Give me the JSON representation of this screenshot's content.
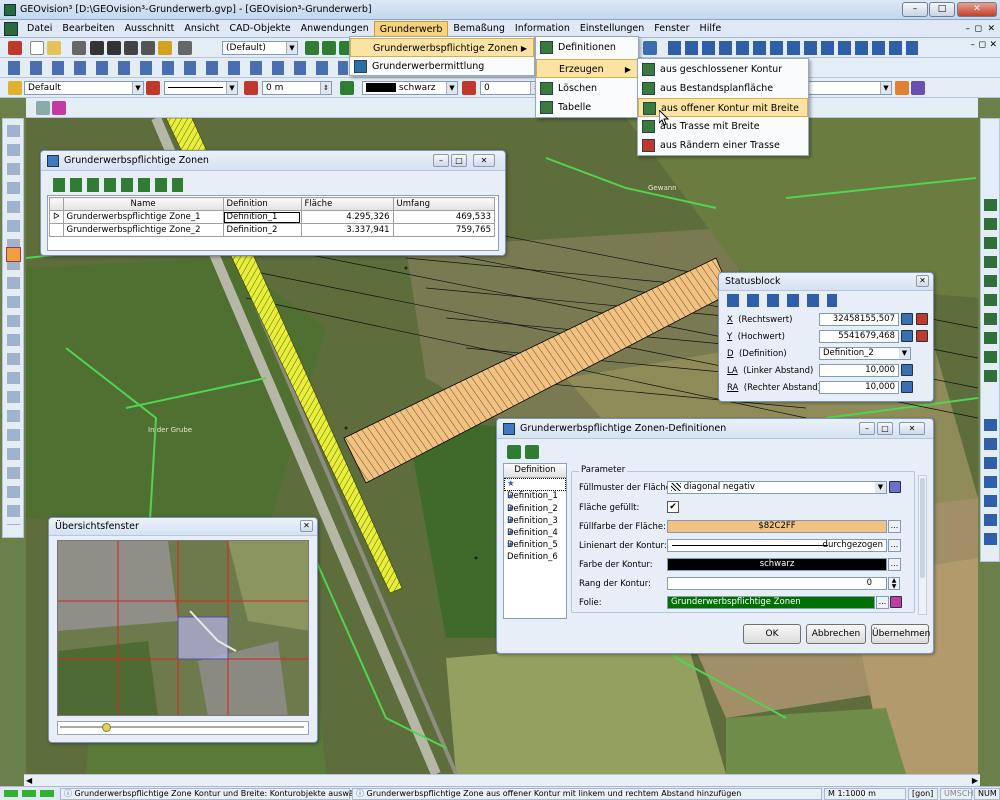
{
  "window": {
    "title": "GEOvision³  [D:\\GEOvision³-Grunderwerb.gvp] - [GEOvision³-Grunderwerb]"
  },
  "menubar": {
    "items": [
      "Datei",
      "Bearbeiten",
      "Ausschnitt",
      "Ansicht",
      "CAD-Objekte",
      "Anwendungen",
      "Grunderwerb",
      "Bemaßung",
      "Information",
      "Einstellungen",
      "Fenster",
      "Hilfe"
    ]
  },
  "toolbar1": {
    "layer_combo": "(Default)"
  },
  "toolbar3": {
    "style_combo": "Default",
    "offset_value": "0 m",
    "color_value": "schwarz",
    "number_value": "0"
  },
  "colors": {
    "accent_orange": "#F2C282",
    "menu_highlight": "#FBE3A3",
    "folie_green": "#007000",
    "title_blue": "#DBE7F5"
  },
  "menus": {
    "level1": {
      "items": [
        "Grunderwerbspflichtige Zonen",
        "Grunderwerbermittlung"
      ]
    },
    "level2": {
      "items": [
        "Definitionen",
        "Erzeugen",
        "Löschen",
        "Tabelle"
      ]
    },
    "level3": {
      "items": [
        "aus geschlossener Kontur",
        "aus Bestandsplanfläche",
        "aus offener Kontur mit Breite",
        "aus Trasse mit Breite",
        "aus Rändern einer Trasse"
      ]
    }
  },
  "zones_window": {
    "title": "Grunderwerbspflichtige Zonen",
    "columns": [
      "Name",
      "Definition",
      "Fläche",
      "Umfang"
    ],
    "rows": [
      {
        "marker": "ᐅ",
        "name": "Grunderwerbspflichtige Zone_1",
        "definition": "Definition_1",
        "flaeche": "4.295,326",
        "umfang": "469,533"
      },
      {
        "marker": "",
        "name": "Grunderwerbspflichtige Zone_2",
        "definition": "Definition_2",
        "flaeche": "3.337,941",
        "umfang": "759,765"
      }
    ]
  },
  "statusblock": {
    "title": "Statusblock",
    "rows": [
      {
        "key": "X",
        "label": "(Rechtswert)",
        "value": "32458155,507"
      },
      {
        "key": "Y",
        "label": "(Hochwert)",
        "value": "5541679,468"
      },
      {
        "key": "D",
        "label": "(Definition)",
        "value": "Definition_2"
      },
      {
        "key": "LA",
        "label": "(Linker Abstand)",
        "value": "10,000"
      },
      {
        "key": "RA",
        "label": "(Rechter Abstand)",
        "value": "10,000"
      }
    ]
  },
  "definitions_window": {
    "title": "Grunderwerbspflichtige Zonen-Definitionen",
    "list_header": "Definition",
    "list": [
      "Definition_1",
      "Definition_2",
      "Definition_3",
      "Definition_4",
      "Definition_5",
      "Definition_6"
    ],
    "group_title": "Parameter",
    "params": {
      "fuellmuster_label": "Füllmuster der Fläche:",
      "fuellmuster_value": "diagonal negativ",
      "gefuellt_label": "Fläche gefüllt:",
      "gefuellt_check": "✔",
      "fuellfarbe_label": "Füllfarbe der Fläche:",
      "fuellfarbe_value": "$82C2FF",
      "linienart_label": "Linienart der Kontur:",
      "linienart_value": "durchgezogen",
      "farbe_label": "Farbe der Kontur:",
      "farbe_value": "schwarz",
      "rang_label": "Rang der Kontur:",
      "rang_value": "0",
      "folie_label": "Folie:",
      "folie_value": "Grunderwerbspflichtige Zonen"
    },
    "buttons": {
      "ok": "OK",
      "cancel": "Abbrechen",
      "apply": "Übernehmen"
    }
  },
  "overview_window": {
    "title": "Übersichtsfenster"
  },
  "map_labels": {
    "l1": "In der Grube",
    "l2": "Gewann"
  },
  "statusbar": {
    "hint1": "Grunderwerbspflichtige Zone Kontur und Breite: Konturobjekte auswählen",
    "hint2": "Grunderwerbspflichtige Zone aus offener Kontur  mit linkem und rechtem Abstand hinzufügen",
    "scale": "M 1:1000  m",
    "unit": "[gon]",
    "umsch": "UMSCH",
    "num": "NUM"
  }
}
